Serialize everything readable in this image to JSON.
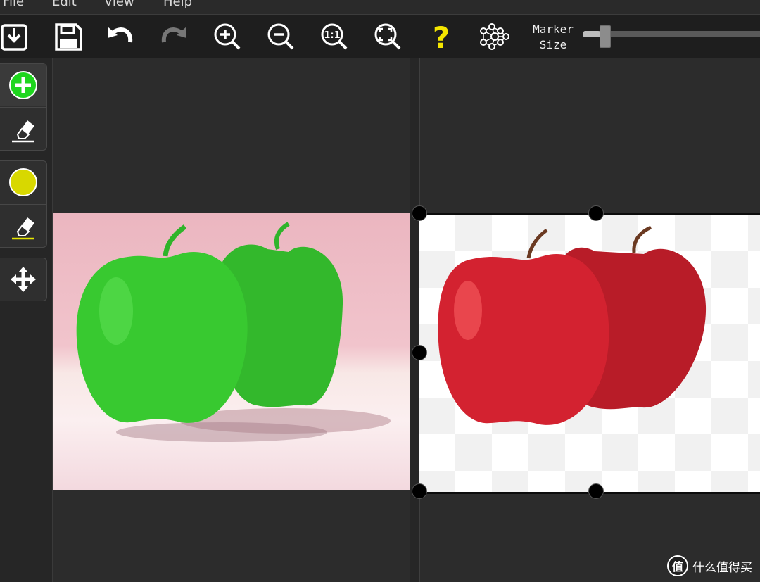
{
  "menu": {
    "items": [
      "File",
      "Edit",
      "View",
      "Help"
    ]
  },
  "toolbar": {
    "buttons": [
      "import-icon",
      "save-icon",
      "undo-icon",
      "redo-icon",
      "zoom-in-icon",
      "zoom-out-icon",
      "zoom-actual-size-icon",
      "zoom-fit-icon",
      "help-icon",
      "neural-network-icon"
    ],
    "zoom_actual_label": "1:1",
    "help_label": "?",
    "marker_label_line1": "Marker",
    "marker_label_line2": "Size",
    "marker_size_fraction": 0.1
  },
  "tools": {
    "foreground_marker": "add-foreground-icon",
    "foreground_eraser": "eraser-icon",
    "background_marker": "background-marker-icon",
    "background_eraser": "eraser-icon",
    "move": "move-icon"
  },
  "colors": {
    "accent_green": "#1ed61e",
    "accent_yellow": "#d8d800",
    "help_yellow": "#f5e600",
    "canvas_bg": "#2c2c2c",
    "apple_green": "#35c92f",
    "apple_red": "#cc1f2a"
  },
  "watermark": {
    "text": "什么值得买",
    "icon_char": "值"
  }
}
